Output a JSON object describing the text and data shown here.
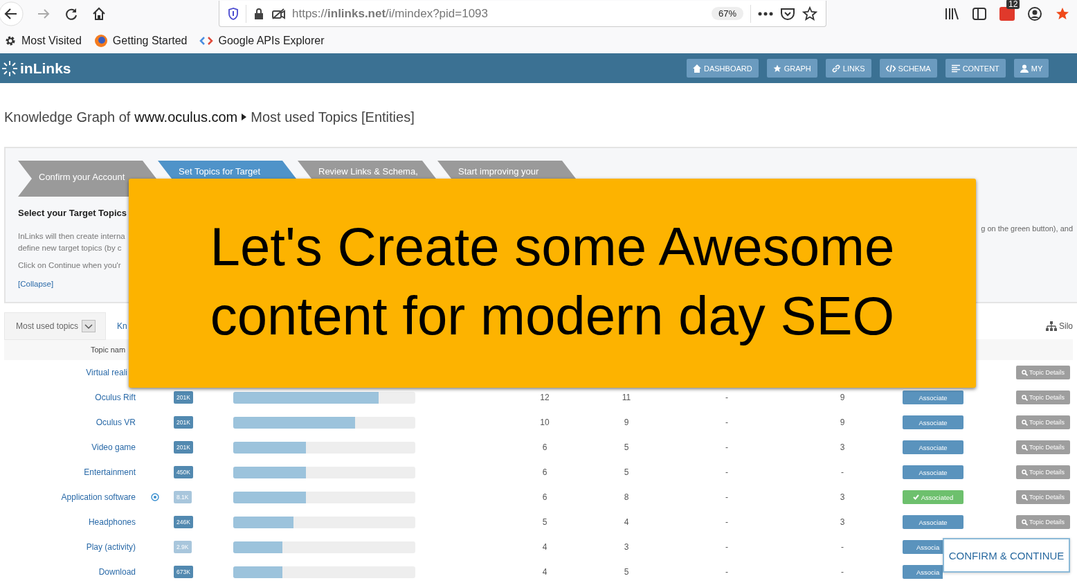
{
  "browser": {
    "url": "https://**inlinks.net**/i/mindex?pid=1093",
    "zoom": "67%",
    "notifications": "12"
  },
  "bookmarks": [
    {
      "kind": "gear",
      "label": "Most Visited"
    },
    {
      "kind": "firefox",
      "label": "Getting Started"
    },
    {
      "kind": "code",
      "label": "Google APIs Explorer"
    }
  ],
  "app": {
    "logo": "inLinks",
    "nav": [
      {
        "kind": "home",
        "label": "DASHBOARD"
      },
      {
        "kind": "star",
        "label": "GRAPH"
      },
      {
        "kind": "link",
        "label": "LINKS"
      },
      {
        "kind": "code",
        "label": "SCHEMA"
      },
      {
        "kind": "list",
        "label": "CONTENT"
      },
      {
        "kind": "user",
        "label": "MY"
      }
    ]
  },
  "breadcrumb": {
    "prefix": "Knowledge Graph of",
    "site": "www.oculus.com",
    "page": "Most used Topics [Entities]"
  },
  "wizard": {
    "steps": [
      {
        "label": "Confirm your Account",
        "selected": false
      },
      {
        "label": "Set Topics for Target",
        "selected": true
      },
      {
        "label": "Review Links & Schema,",
        "selected": false
      },
      {
        "label": "Start improving your",
        "selected": false
      }
    ],
    "heading": "Select your Target Topics",
    "intro_lines": [
      "InLinks will then create interna",
      "define new target topics (by c"
    ],
    "note": "Click on Continue when you'r",
    "collapse": "[Collapse]",
    "right_text": "g on the green button), and"
  },
  "tabs": [
    {
      "label": "Most used topics",
      "selected": true
    },
    {
      "label": "Kn",
      "selected": false
    }
  ],
  "silo": "Silo",
  "table": {
    "column_1": "Topic nam",
    "rows": [
      {
        "name": "Virtual reali",
        "details": "Topic Details"
      },
      {
        "name": "Oculus Rift",
        "targeted": false,
        "badge": "201K",
        "dim": false,
        "level": 0.8,
        "cells": [
          "12",
          "11",
          "-",
          "9"
        ],
        "action": {
          "label": "Associate",
          "associated": false
        },
        "details": "Topic Details"
      },
      {
        "name": "Oculus VR",
        "targeted": false,
        "badge": "201K",
        "dim": false,
        "level": 0.67,
        "cells": [
          "10",
          "9",
          "-",
          "9"
        ],
        "action": {
          "label": "Associate",
          "associated": false
        },
        "details": "Topic Details"
      },
      {
        "name": "Video game",
        "targeted": false,
        "badge": "201K",
        "dim": false,
        "level": 0.4,
        "cells": [
          "6",
          "5",
          "-",
          "3"
        ],
        "action": {
          "label": "Associate",
          "associated": false
        },
        "details": "Topic Details"
      },
      {
        "name": "Entertainment",
        "targeted": false,
        "badge": "450K",
        "dim": false,
        "level": 0.4,
        "cells": [
          "6",
          "5",
          "-",
          "-"
        ],
        "action": {
          "label": "Associate",
          "associated": false
        },
        "details": "Topic Details"
      },
      {
        "name": "Application software",
        "targeted": true,
        "badge": "8.1K",
        "dim": true,
        "level": 0.4,
        "cells": [
          "6",
          "8",
          "-",
          "3"
        ],
        "action": {
          "label": "Associated",
          "associated": true
        },
        "details": "Topic Details"
      },
      {
        "name": "Headphones",
        "targeted": false,
        "badge": "246K",
        "dim": false,
        "level": 0.33,
        "cells": [
          "5",
          "4",
          "-",
          "3"
        ],
        "action": {
          "label": "Associate",
          "associated": false
        },
        "details": "Topic Details"
      },
      {
        "name": "Play (activity)",
        "targeted": false,
        "badge": "2.9K",
        "dim": true,
        "level": 0.27,
        "cells": [
          "4",
          "3",
          "-",
          "-"
        ],
        "action": {
          "label": "Associa",
          "associated": false
        }
      },
      {
        "name": "Download",
        "targeted": false,
        "badge": "673K",
        "dim": false,
        "level": 0.27,
        "cells": [
          "4",
          "5",
          "-",
          "-"
        ],
        "action": {
          "label": "Associa",
          "associated": false
        }
      }
    ]
  },
  "banner": {
    "lines": [
      "Let's Create some Awesome",
      "content for modern day SEO"
    ]
  },
  "confirm_button": "CONFIRM & CONTINUE"
}
